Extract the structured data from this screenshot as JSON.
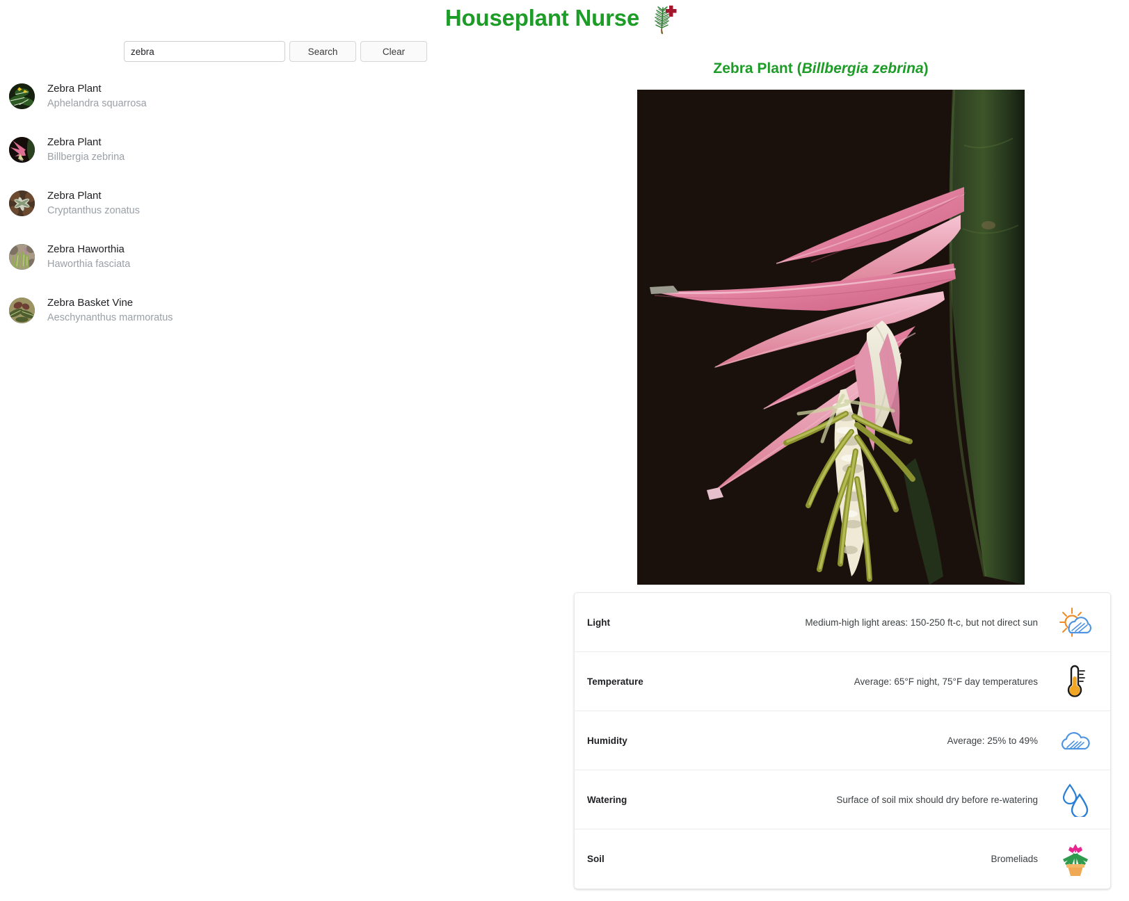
{
  "header": {
    "title": "Houseplant Nurse",
    "logo_icon": "fir-branch-with-red-cross-icon",
    "title_color": "#1d9c28"
  },
  "search": {
    "value": "zebra",
    "placeholder": "",
    "search_label": "Search",
    "clear_label": "Clear"
  },
  "results": [
    {
      "common": "Zebra Plant",
      "scientific": "Aphelandra squarrosa",
      "thumb": "aphelandra-thumb"
    },
    {
      "common": "Zebra Plant",
      "scientific": "Billbergia zebrina",
      "thumb": "billbergia-thumb"
    },
    {
      "common": "Zebra Plant",
      "scientific": "Cryptanthus zonatus",
      "thumb": "cryptanthus-thumb"
    },
    {
      "common": "Zebra Haworthia",
      "scientific": "Haworthia fasciata",
      "thumb": "haworthia-thumb"
    },
    {
      "common": "Zebra Basket Vine",
      "scientific": "Aeschynanthus marmoratus",
      "thumb": "aeschynanthus-thumb"
    }
  ],
  "detail": {
    "common_name": "Zebra Plant",
    "open_paren": " (",
    "scientific_name": "Billbergia zebrina",
    "close_paren": ")",
    "photo_alt": "Pink bracts of Billbergia zebrina inflorescence on dark background",
    "care": [
      {
        "label": "Light",
        "value": "Medium-high light areas: 150-250 ft-c, but not direct sun",
        "icon": "sun-behind-cloud-icon"
      },
      {
        "label": "Temperature",
        "value": "Average: 65°F night, 75°F day temperatures",
        "icon": "thermometer-icon"
      },
      {
        "label": "Humidity",
        "value": "Average: 25% to 49%",
        "icon": "cloud-icon"
      },
      {
        "label": "Watering",
        "value": "Surface of soil mix should dry before re-watering",
        "icon": "water-drops-icon"
      },
      {
        "label": "Soil",
        "value": "Bromeliads",
        "icon": "potted-bromeliad-icon"
      }
    ]
  }
}
